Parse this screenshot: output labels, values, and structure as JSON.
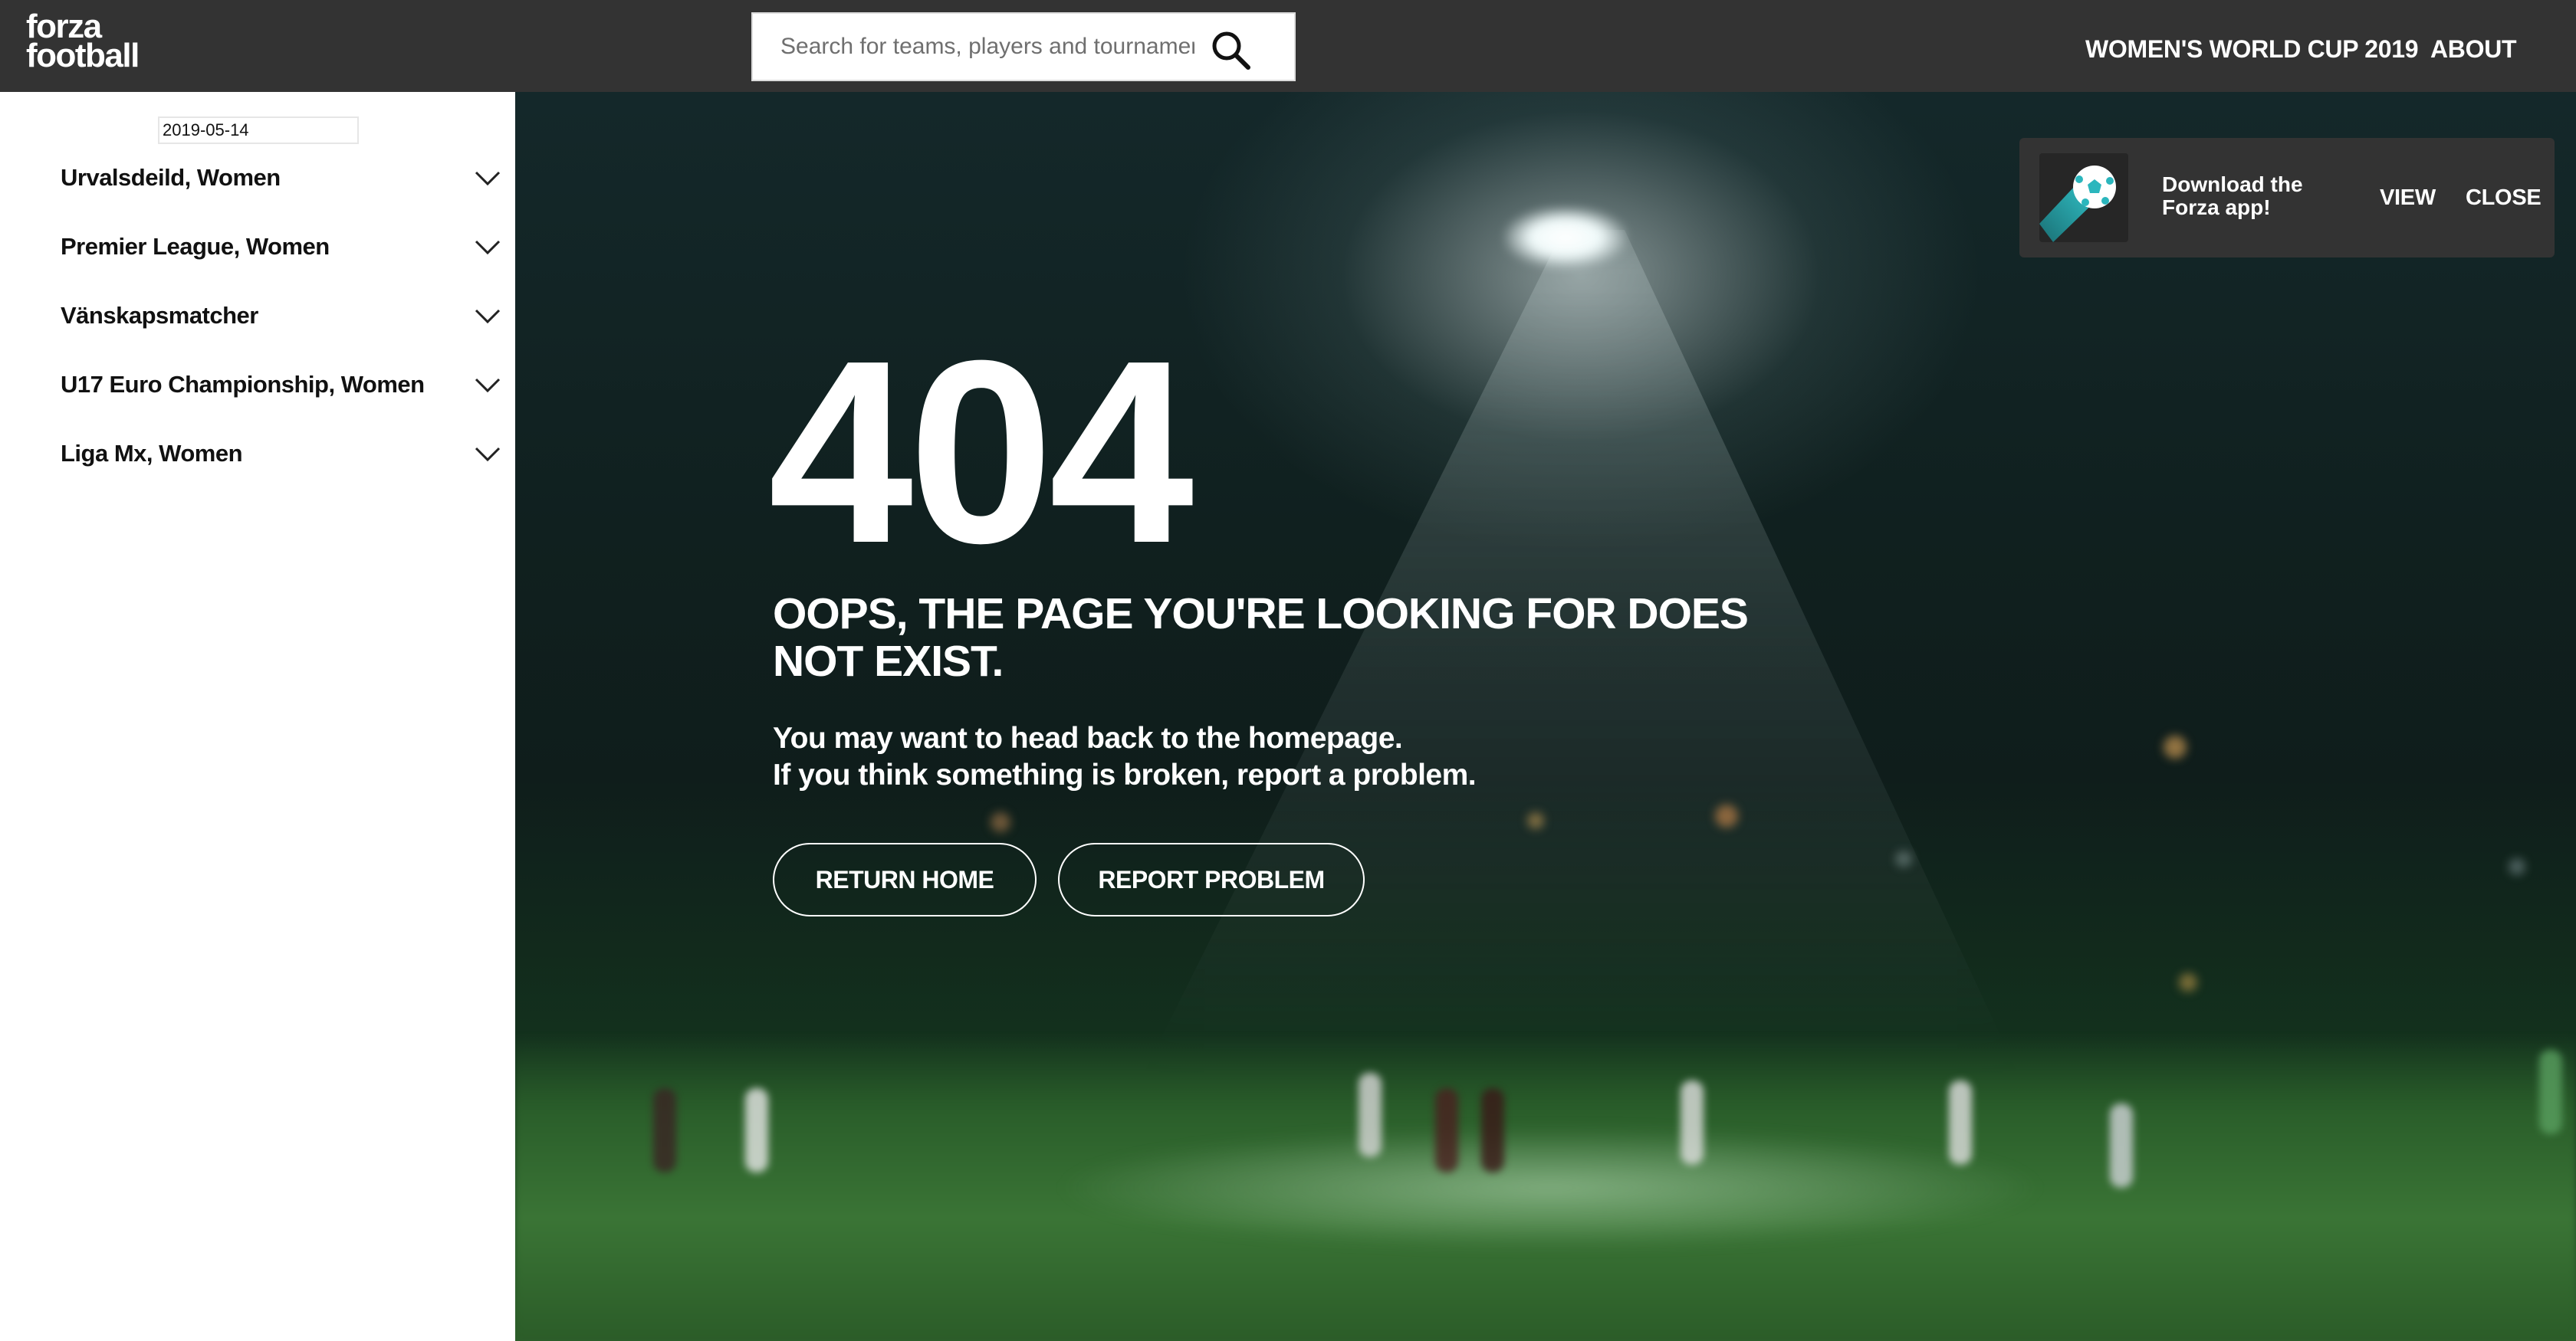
{
  "header": {
    "logo_line1": "forza",
    "logo_line2": "football",
    "search_placeholder": "Search for teams, players and tournaments",
    "nav": {
      "womens_world_cup": "WOMEN'S WORLD CUP 2019",
      "about": "ABOUT"
    }
  },
  "sidebar": {
    "date": "2019-05-14",
    "leagues": [
      {
        "label": "Urvalsdeild, Women"
      },
      {
        "label": "Premier League, Women"
      },
      {
        "label": "Vänskapsmatcher"
      },
      {
        "label": "U17 Euro Championship, Women"
      },
      {
        "label": "Liga Mx, Women"
      }
    ]
  },
  "error": {
    "code": "404",
    "title": "OOPS, THE PAGE YOU'RE LOOKING FOR DOES NOT EXIST.",
    "line1": "You may want to head back to the homepage.",
    "line2": "If you think something is broken, report a problem.",
    "return_home": "RETURN HOME",
    "report_problem": "REPORT PROBLEM"
  },
  "app_banner": {
    "text": "Download the Forza app!",
    "view": "VIEW",
    "close": "CLOSE"
  },
  "colors": {
    "topbar": "#333333",
    "sidebar": "#ffffff",
    "text_light": "#ffffff",
    "app_icon_accent": "#29c1c8"
  },
  "icons": [
    "search-icon",
    "chevron-down-icon",
    "forza-app-icon",
    "football-icon"
  ]
}
